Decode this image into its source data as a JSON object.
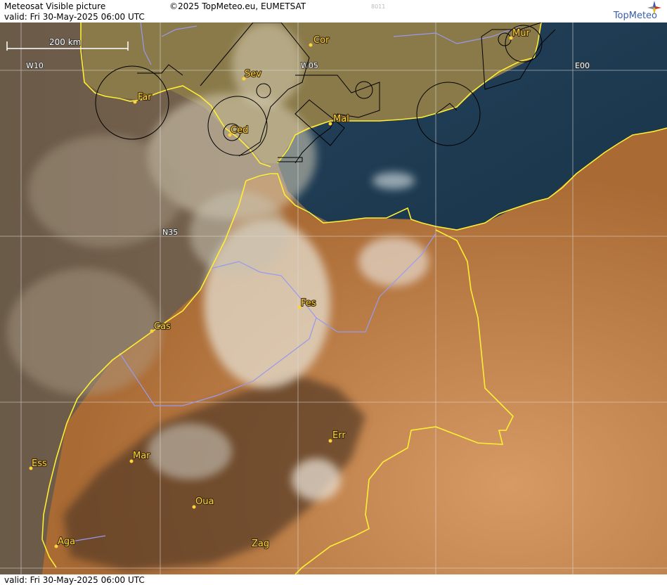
{
  "header": {
    "title": "Meteosat Visible picture",
    "valid": "valid:  Fri  30-May-2025  06:00 UTC",
    "copyright": "©2025 TopMeteo.eu, EUMETSAT",
    "code": "8011",
    "logo_text": "TopMeteo"
  },
  "footer": {
    "valid": "valid:  Fri  30-May-2025  06:00 UTC"
  },
  "map": {
    "scale_label": "200 km",
    "grid_labels": {
      "w10": "W10",
      "w05": "W05",
      "e00": "E00",
      "n35": "N35"
    },
    "cities": [
      {
        "id": "cor",
        "name": "Cor"
      },
      {
        "id": "mur",
        "name": "Mur"
      },
      {
        "id": "sev",
        "name": "Sev"
      },
      {
        "id": "far",
        "name": "Far"
      },
      {
        "id": "ced",
        "name": "Ced"
      },
      {
        "id": "mal",
        "name": "Mal"
      },
      {
        "id": "fes",
        "name": "Fes"
      },
      {
        "id": "cas",
        "name": "Cas"
      },
      {
        "id": "err",
        "name": "Err"
      },
      {
        "id": "ess",
        "name": "Ess"
      },
      {
        "id": "mar",
        "name": "Mar"
      },
      {
        "id": "oua",
        "name": "Oua"
      },
      {
        "id": "aga",
        "name": "Aga"
      },
      {
        "id": "zag",
        "name": "Zag"
      }
    ],
    "colors": {
      "coastline": "#ffee33",
      "border": "#9999ee",
      "airspace": "#000000",
      "grid": "#dddddd",
      "sea": "#1d3b55",
      "land": "#b7783f"
    }
  }
}
